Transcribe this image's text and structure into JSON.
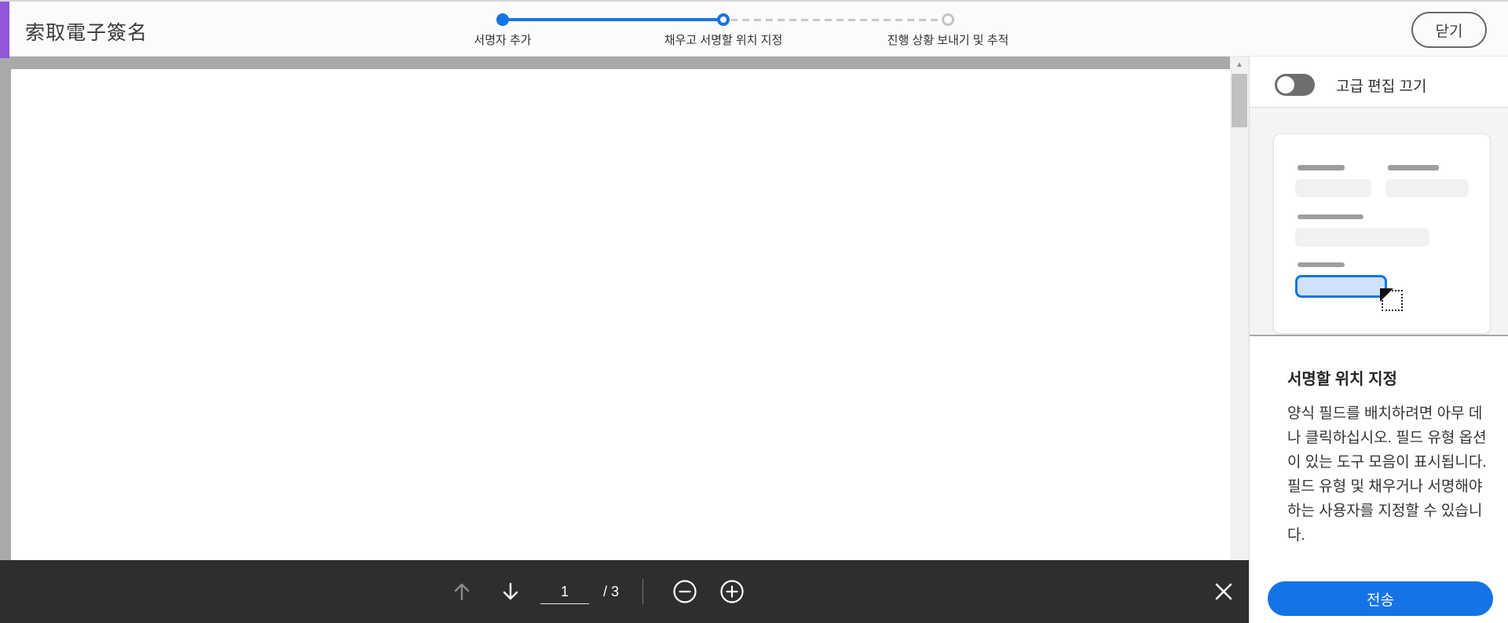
{
  "header": {
    "title": "索取電子簽名",
    "close_label": "닫기",
    "accent_color": "#9256D9"
  },
  "stepper": {
    "accent_color": "#1473E6",
    "steps": [
      {
        "label": "서명자 추가",
        "state": "complete"
      },
      {
        "label": "채우고 서명할 위치 지정",
        "state": "current"
      },
      {
        "label": "진행 상황 보내기 및 추적",
        "state": "upcoming"
      }
    ]
  },
  "side_panel": {
    "toggle_label": "고급 편집 끄기",
    "toggle_state": "off",
    "section": {
      "heading": "서명할 위치 지정",
      "body": "양식 필드를 배치하려면 아무 데나 클릭하십시오. 필드 유형 옵션이 있는 도구 모음이 표시됩니다. 필드 유형 및 채우거나 서명해야 하는 사용자를 지정할 수 있습니다."
    },
    "send_button": "전송",
    "send_color": "#1473E6"
  },
  "toolbar": {
    "page_value": "1",
    "page_total": "/ 3",
    "icons": {
      "previous_page": "arrow-up (disabled)",
      "next_page": "arrow-down",
      "zoom_out": "minus-circle",
      "zoom_in": "plus-circle",
      "close": "x"
    },
    "background": "#2e2e2e"
  },
  "viewer": {
    "page_number_shown": "1",
    "background": "#a9a9a9"
  }
}
